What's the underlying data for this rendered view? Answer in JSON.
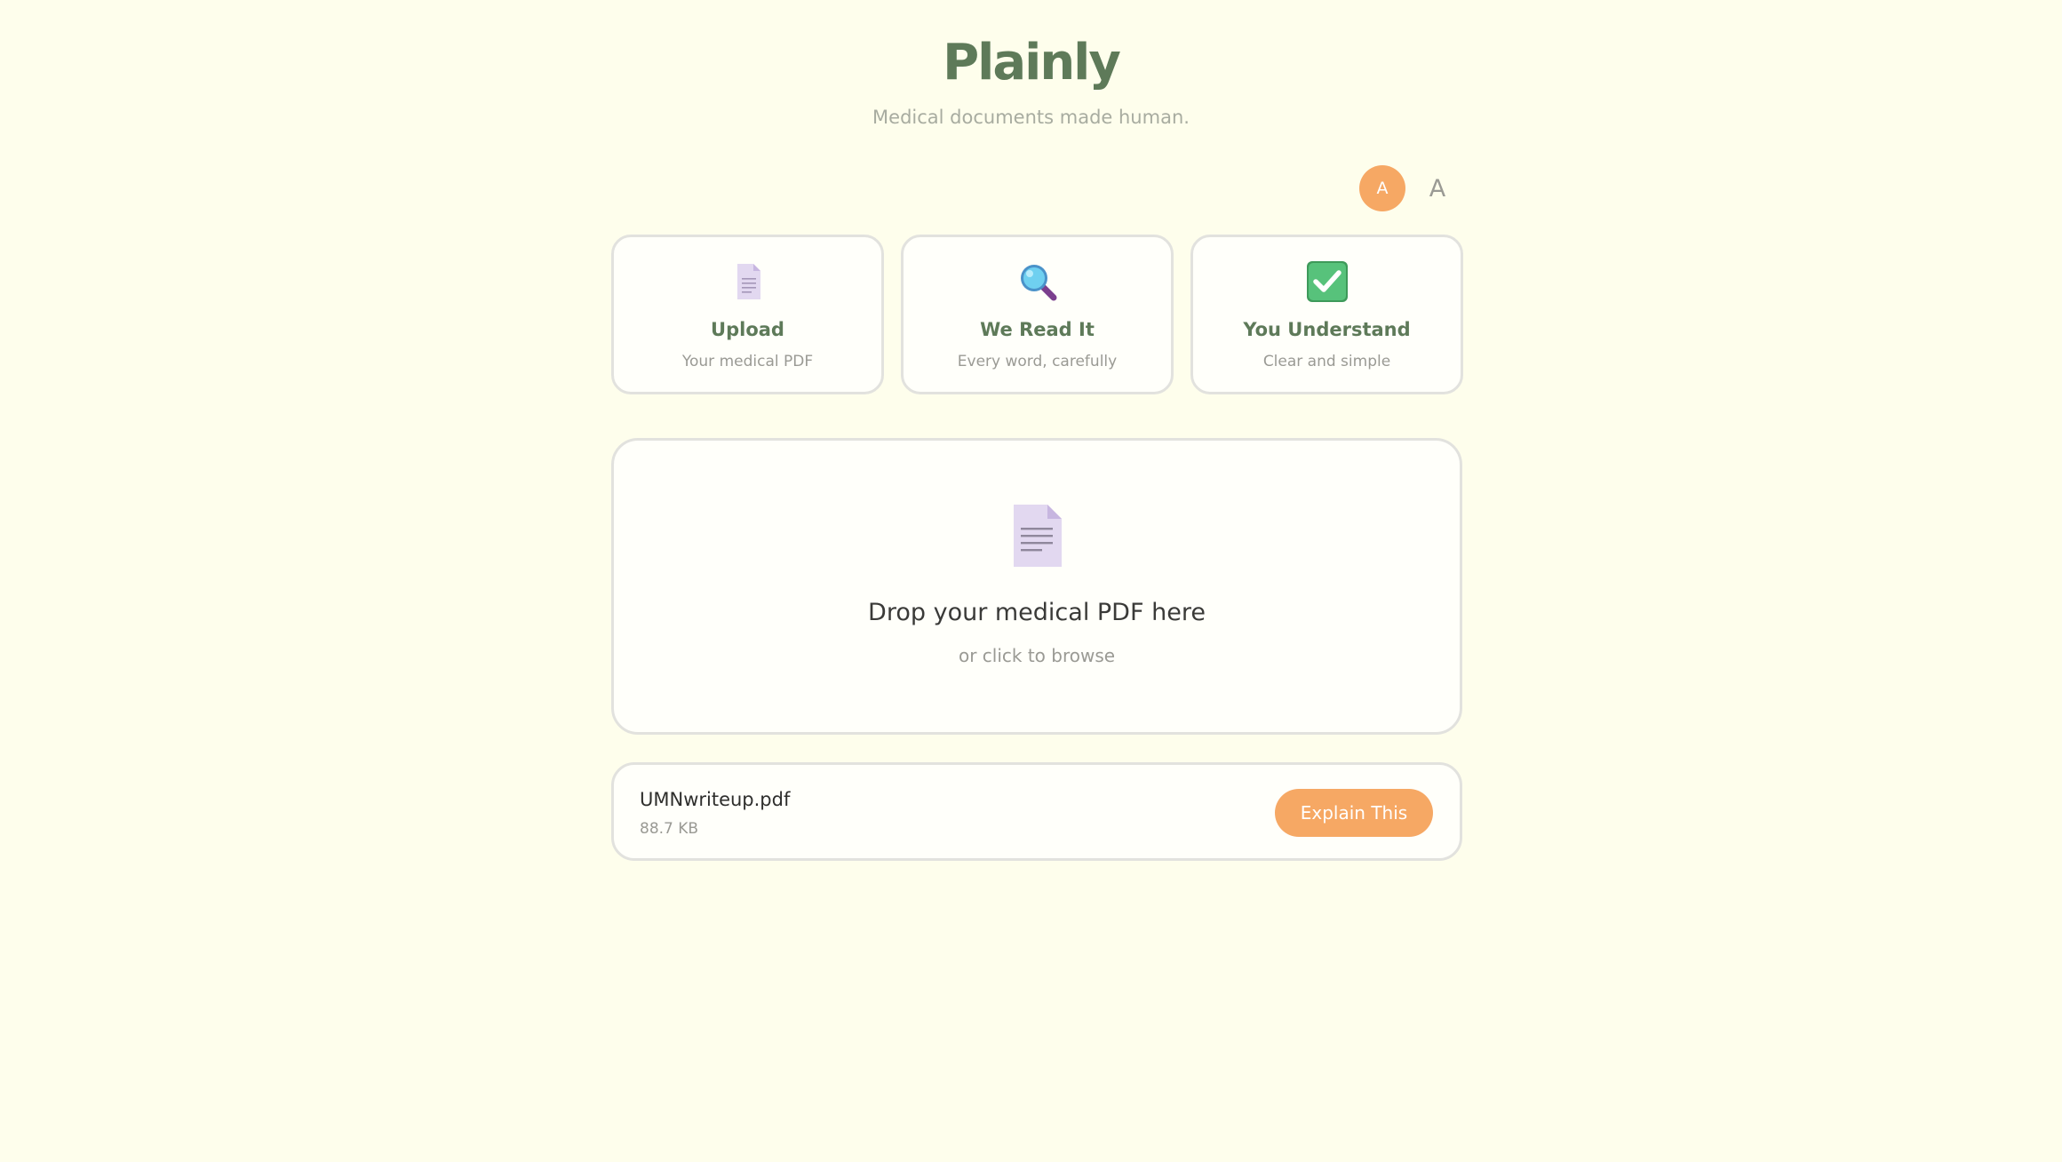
{
  "header": {
    "brand": "Plainly",
    "tagline": "Medical documents made human."
  },
  "font_toggle": {
    "active_label": "A",
    "inactive_label": "A"
  },
  "steps": [
    {
      "icon": "document-icon",
      "title": "Upload",
      "subtitle": "Your medical PDF"
    },
    {
      "icon": "magnifier-icon",
      "title": "We Read It",
      "subtitle": "Every word, carefully"
    },
    {
      "icon": "checkmark-icon",
      "title": "You Understand",
      "subtitle": "Clear and simple"
    }
  ],
  "dropzone": {
    "icon": "document-icon",
    "title": "Drop your medical PDF here",
    "subtitle": "or click to browse"
  },
  "file": {
    "name": "UMNwriteup.pdf",
    "size": "88.7 KB",
    "action_label": "Explain This"
  },
  "colors": {
    "background": "#fefeec",
    "brand": "#5e7a59",
    "accent": "#f6a864",
    "card_border": "#e2e2de"
  }
}
